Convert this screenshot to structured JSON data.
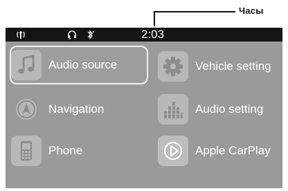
{
  "callout": {
    "label": "Часы"
  },
  "status_bar": {
    "time": "2:03",
    "icons": [
      "phone-signal-icon",
      "headset-icon",
      "bluetooth-icon"
    ]
  },
  "menu": {
    "items": [
      {
        "label": "Audio source",
        "icon": "music-note-icon",
        "selected": true
      },
      {
        "label": "Vehicle setting",
        "icon": "gear-icon",
        "selected": false
      },
      {
        "label": "Navigation",
        "icon": "navigation-arrow-icon",
        "selected": false
      },
      {
        "label": "Audio setting",
        "icon": "equalizer-icon",
        "selected": false
      },
      {
        "label": "Phone",
        "icon": "phone-icon",
        "selected": false
      },
      {
        "label": "Apple CarPlay",
        "icon": "carplay-icon",
        "selected": false
      }
    ]
  },
  "colors": {
    "screen_bg": "#9a9a9a",
    "status_bg": "#141414",
    "tile_bg": "#b8b8b8",
    "text": "#ffffff"
  }
}
